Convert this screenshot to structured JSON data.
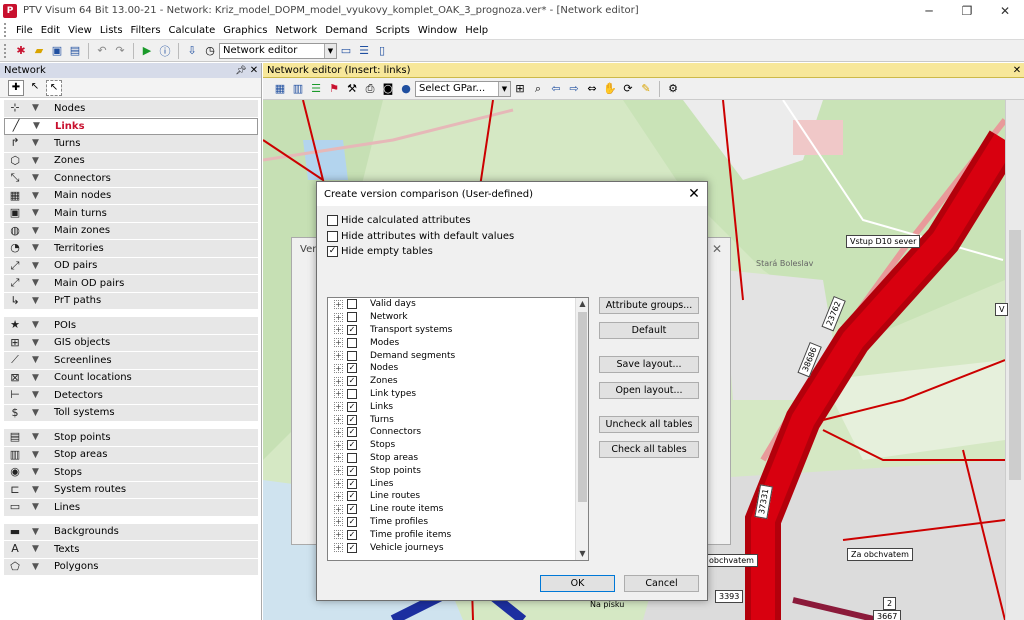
{
  "window": {
    "title": "PTV Visum 64 Bit 13.00-21 - Network: Kriz_model_DOPM_model_vyukovy_komplet_OAK_3_prognoza.ver* - [Network editor]",
    "minimize_glyph": "─",
    "restore_glyph": "❐",
    "close_glyph": "✕"
  },
  "menu": [
    "File",
    "Edit",
    "View",
    "Lists",
    "Filters",
    "Calculate",
    "Graphics",
    "Network",
    "Demand",
    "Scripts",
    "Window",
    "Help"
  ],
  "toolbar": {
    "mode_select_value": "Network editor"
  },
  "network_panel": {
    "title": "Network",
    "items_group1": [
      {
        "label": "Nodes",
        "icon": "node-icon",
        "glyph": "⊹"
      },
      {
        "label": "Links",
        "icon": "link-icon",
        "glyph": "╱",
        "selected": true
      },
      {
        "label": "Turns",
        "icon": "turn-icon",
        "glyph": "↱"
      },
      {
        "label": "Zones",
        "icon": "zone-icon",
        "glyph": "⬡"
      },
      {
        "label": "Connectors",
        "icon": "connector-icon",
        "glyph": "⤡"
      },
      {
        "label": "Main nodes",
        "icon": "main-node-icon",
        "glyph": "▦"
      },
      {
        "label": "Main turns",
        "icon": "main-turn-icon",
        "glyph": "▣"
      },
      {
        "label": "Main zones",
        "icon": "main-zone-icon",
        "glyph": "◍"
      },
      {
        "label": "Territories",
        "icon": "territory-icon",
        "glyph": "◔"
      },
      {
        "label": "OD pairs",
        "icon": "od-pair-icon",
        "glyph": "⤢"
      },
      {
        "label": "Main OD pairs",
        "icon": "main-od-pair-icon",
        "glyph": "⤢"
      },
      {
        "label": "PrT paths",
        "icon": "prt-path-icon",
        "glyph": "↳"
      }
    ],
    "items_group2": [
      {
        "label": "POIs",
        "icon": "poi-icon",
        "glyph": "★"
      },
      {
        "label": "GIS objects",
        "icon": "gis-object-icon",
        "glyph": "⊞"
      },
      {
        "label": "Screenlines",
        "icon": "screenline-icon",
        "glyph": "⟋"
      },
      {
        "label": "Count locations",
        "icon": "count-location-icon",
        "glyph": "⊠"
      },
      {
        "label": "Detectors",
        "icon": "detector-icon",
        "glyph": "⊢"
      },
      {
        "label": "Toll systems",
        "icon": "toll-system-icon",
        "glyph": "$"
      }
    ],
    "items_group3": [
      {
        "label": "Stop points",
        "icon": "stop-point-icon",
        "glyph": "▤"
      },
      {
        "label": "Stop areas",
        "icon": "stop-area-icon",
        "glyph": "▥"
      },
      {
        "label": "Stops",
        "icon": "stop-icon",
        "glyph": "◉"
      },
      {
        "label": "System routes",
        "icon": "system-route-icon",
        "glyph": "⊏"
      },
      {
        "label": "Lines",
        "icon": "line-icon",
        "glyph": "▭"
      }
    ],
    "items_group4": [
      {
        "label": "Backgrounds",
        "icon": "background-icon",
        "glyph": "▬"
      },
      {
        "label": "Texts",
        "icon": "text-icon",
        "glyph": "A"
      },
      {
        "label": "Polygons",
        "icon": "polygon-icon",
        "glyph": "⬠"
      }
    ]
  },
  "editor": {
    "title": "Network editor (Insert: links)",
    "select_value": "Select GPar..."
  },
  "map_labels": {
    "vstup": "Vstup D10 sever",
    "za_obchvatem": "Za obchvatem",
    "obchvatem": "obchvatem",
    "na_pisku": "Na písku",
    "stara_boleslav": "Stará Boleslav",
    "l1": "23762",
    "l2": "38686",
    "l3": "37331",
    "l4": "3393",
    "l5": "3667",
    "l6": "2",
    "l7": "V"
  },
  "back_dialog_title": "Vers",
  "dialog": {
    "title": "Create version comparison (User-defined)",
    "options": [
      {
        "label": "Hide calculated attributes",
        "checked": false
      },
      {
        "label": "Hide attributes with default values",
        "checked": false
      },
      {
        "label": "Hide empty tables",
        "checked": true
      }
    ],
    "tables": [
      {
        "label": "Valid days",
        "checked": false
      },
      {
        "label": "Network",
        "checked": false
      },
      {
        "label": "Transport systems",
        "checked": true
      },
      {
        "label": "Modes",
        "checked": false
      },
      {
        "label": "Demand segments",
        "checked": false
      },
      {
        "label": "Nodes",
        "checked": true
      },
      {
        "label": "Zones",
        "checked": true
      },
      {
        "label": "Link types",
        "checked": false
      },
      {
        "label": "Links",
        "checked": true
      },
      {
        "label": "Turns",
        "checked": true
      },
      {
        "label": "Connectors",
        "checked": true
      },
      {
        "label": "Stops",
        "checked": true
      },
      {
        "label": "Stop areas",
        "checked": false
      },
      {
        "label": "Stop points",
        "checked": true
      },
      {
        "label": "Lines",
        "checked": true
      },
      {
        "label": "Line routes",
        "checked": true
      },
      {
        "label": "Line route items",
        "checked": true
      },
      {
        "label": "Time profiles",
        "checked": true
      },
      {
        "label": "Time profile items",
        "checked": true
      },
      {
        "label": "Vehicle journeys",
        "checked": true
      }
    ],
    "buttons": {
      "attribute_groups": "Attribute groups...",
      "default": "Default",
      "save_layout": "Save layout...",
      "open_layout": "Open layout...",
      "uncheck_all": "Uncheck all tables",
      "check_all": "Check all tables",
      "ok": "OK",
      "cancel": "Cancel"
    }
  },
  "colors": {
    "accent_red": "#c8102e",
    "editor_header": "#f7e79a",
    "map_green": "#d5e8c4",
    "link_red": "#cc0000"
  }
}
